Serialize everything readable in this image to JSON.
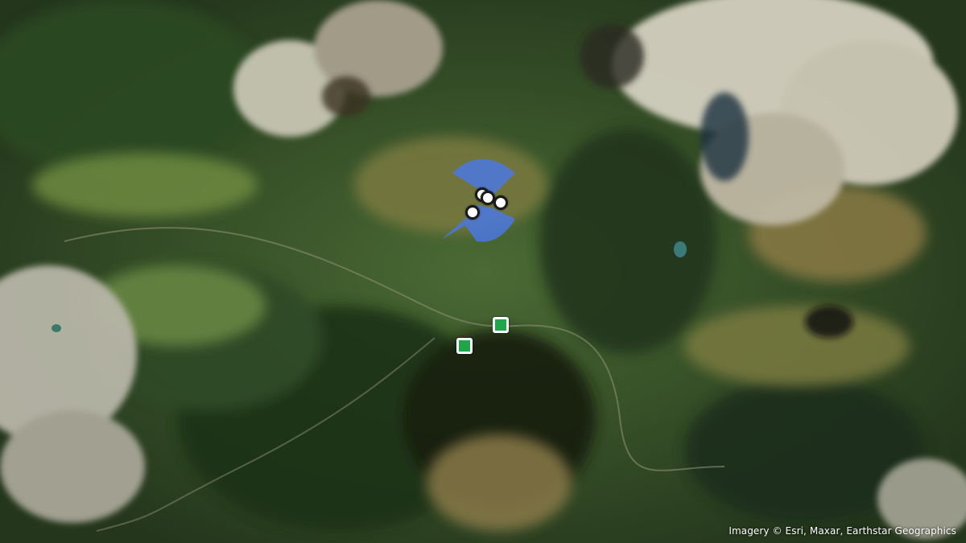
{
  "map": {
    "type": "satellite",
    "attribution": "Imagery © Esri, Maxar, Earthstar Geographics"
  },
  "overlays": {
    "coverage_color": "#4a78e0"
  },
  "markers": {
    "circle_color": "#ffffff",
    "square_color": "#1fa64a"
  }
}
